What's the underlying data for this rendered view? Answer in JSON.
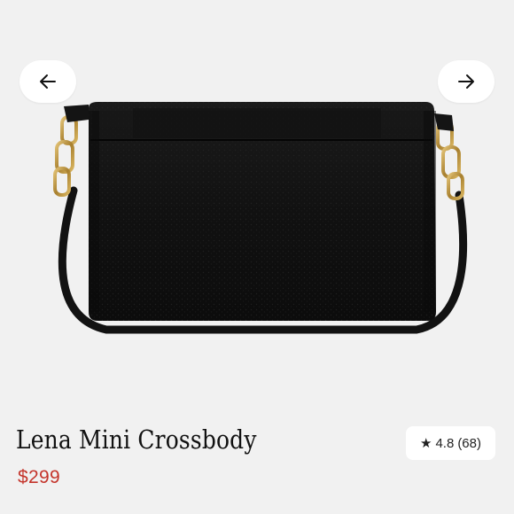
{
  "product": {
    "name": "Lena Mini Crossbody",
    "price": "$299",
    "rating": {
      "icon": "star-icon",
      "value": "4.8",
      "count": "(68)"
    },
    "image": {
      "subject": "black-pebbled-leather-crossbody-bag"
    }
  },
  "carousel": {
    "prev_icon": "arrow-left-icon",
    "next_icon": "arrow-right-icon"
  },
  "colors": {
    "background": "#f1f1f1",
    "price": "#c4342b",
    "bag": "#131313",
    "hardware": "#b58d3d",
    "button": "#ffffff"
  }
}
